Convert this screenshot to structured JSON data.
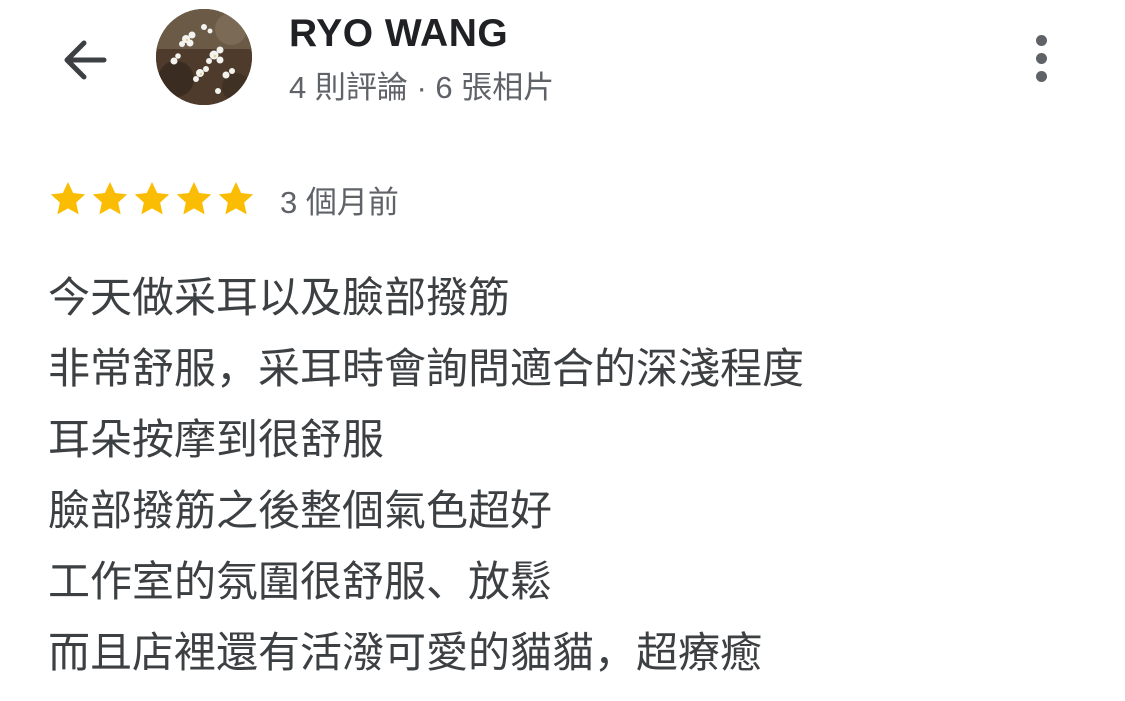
{
  "header": {
    "back_icon": "arrow-left-icon",
    "user_name": "RYO WANG",
    "user_meta": "4 則評論 · 6 張相片",
    "more_icon": "more-vert-icon"
  },
  "review": {
    "rating": 5,
    "rating_max": 5,
    "star_color": "#fbbc04",
    "time": "3 個月前",
    "lines": [
      "今天做采耳以及臉部撥筋",
      "非常舒服，采耳時會詢問適合的深淺程度",
      "耳朵按摩到很舒服",
      "臉部撥筋之後整個氣色超好",
      "工作室的氛圍很舒服、放鬆",
      "而且店裡還有活潑可愛的貓貓，超療癒"
    ]
  }
}
